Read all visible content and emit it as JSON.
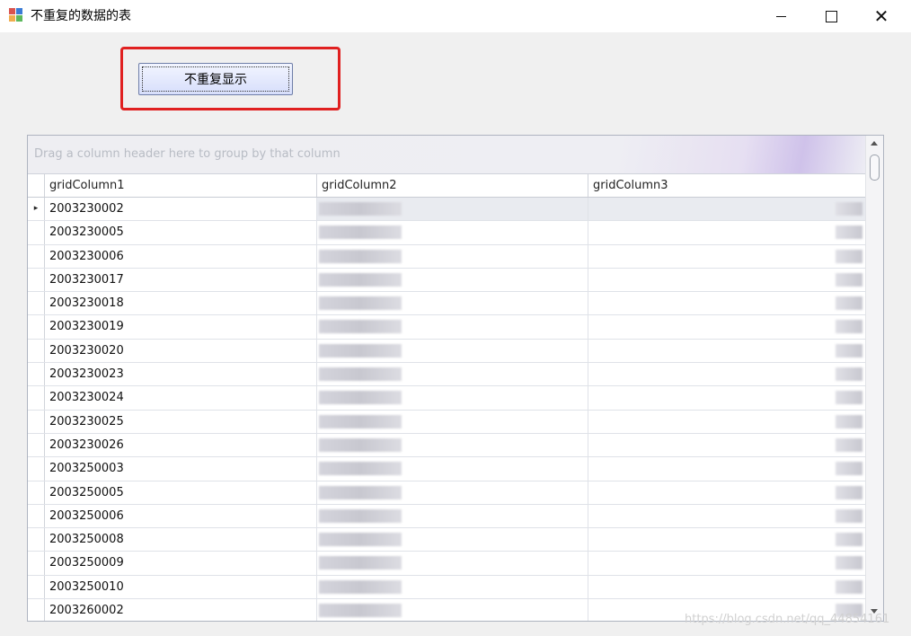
{
  "window": {
    "title": "不重复的数据的表",
    "minimize_glyph": "",
    "maximize_glyph": "",
    "close_glyph": "✕"
  },
  "toolbar": {
    "dedup_button_label": "不重复显示"
  },
  "grid": {
    "group_panel_hint": "Drag a column header here to group by that column",
    "columns": [
      "gridColumn1",
      "gridColumn2",
      "gridColumn3"
    ],
    "selected_row_indicator": "▸",
    "rows": [
      {
        "col1": "2003230002"
      },
      {
        "col1": "2003230005"
      },
      {
        "col1": "2003230006"
      },
      {
        "col1": "2003230017"
      },
      {
        "col1": "2003230018"
      },
      {
        "col1": "2003230019"
      },
      {
        "col1": "2003230020"
      },
      {
        "col1": "2003230023"
      },
      {
        "col1": "2003230024"
      },
      {
        "col1": "2003230025"
      },
      {
        "col1": "2003230026"
      },
      {
        "col1": "2003250003"
      },
      {
        "col1": "2003250005"
      },
      {
        "col1": "2003250006"
      },
      {
        "col1": "2003250008"
      },
      {
        "col1": "2003250009"
      },
      {
        "col1": "2003250010"
      },
      {
        "col1": "2003260002"
      }
    ]
  },
  "watermark": "https://blog.csdn.net/qq_44854161",
  "colors": {
    "highlight": "#e02020",
    "button_gradient_top": "#f2f5ff",
    "button_gradient_bottom": "#d7defb"
  }
}
